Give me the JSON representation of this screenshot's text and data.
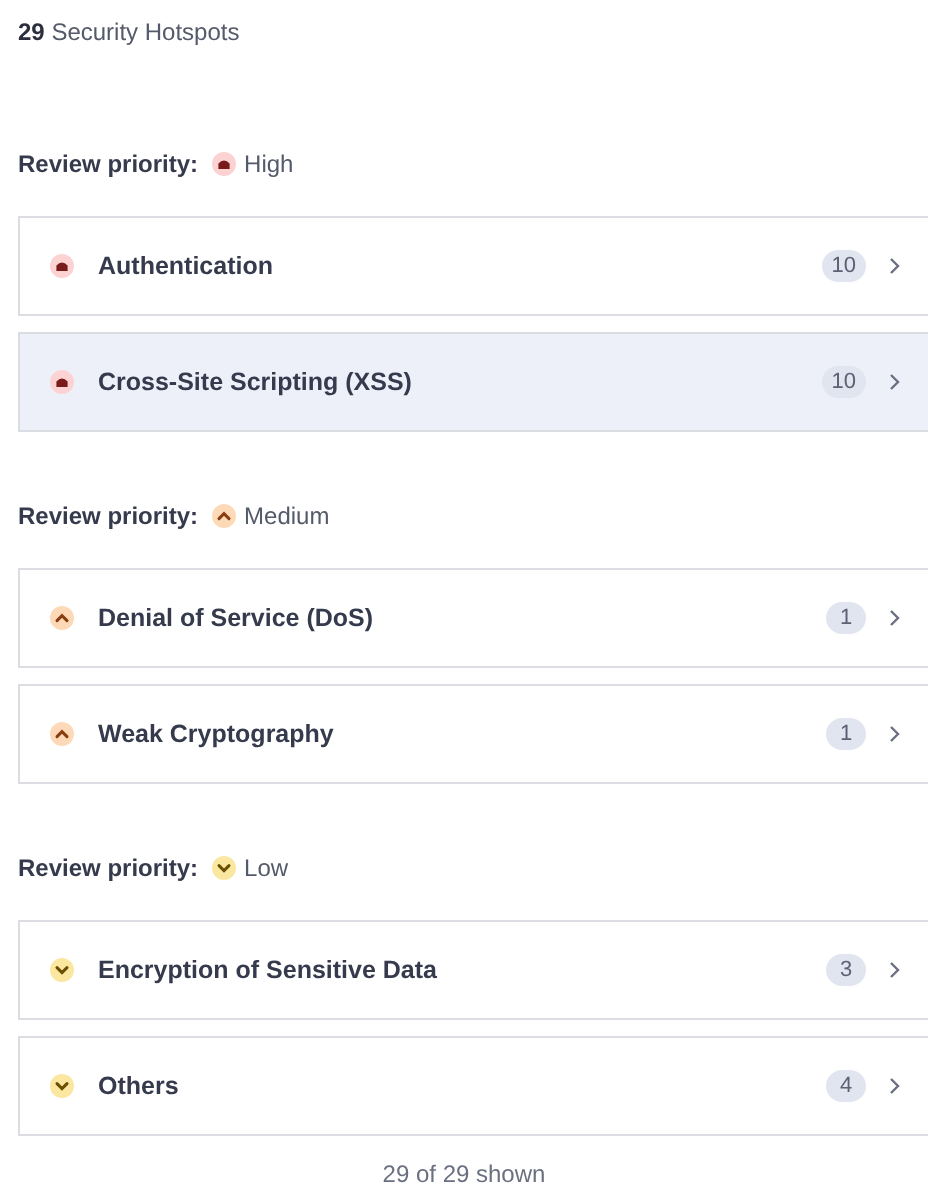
{
  "summary": "**29** Security Hotspots",
  "groups": [
    {
      "label": "Review priority:",
      "kind": "high",
      "priority_label": "High",
      "categories": [
        {
          "name": "Authentication",
          "count": "10",
          "selected": false
        },
        {
          "name": "Cross-Site Scripting (XSS)",
          "count": "10",
          "selected": true
        }
      ]
    },
    {
      "label": "Review priority:",
      "kind": "medium",
      "priority_label": "Medium",
      "categories": [
        {
          "name": "Denial of Service (DoS)",
          "count": "1",
          "selected": false
        },
        {
          "name": "Weak Cryptography",
          "count": "1",
          "selected": false
        }
      ]
    },
    {
      "label": "Review priority:",
      "kind": "low",
      "priority_label": "Low",
      "categories": [
        {
          "name": "Encryption of Sensitive Data",
          "count": "3",
          "selected": false
        },
        {
          "name": "Others",
          "count": "4",
          "selected": false
        }
      ]
    }
  ],
  "footer": "29 of 29 shown"
}
